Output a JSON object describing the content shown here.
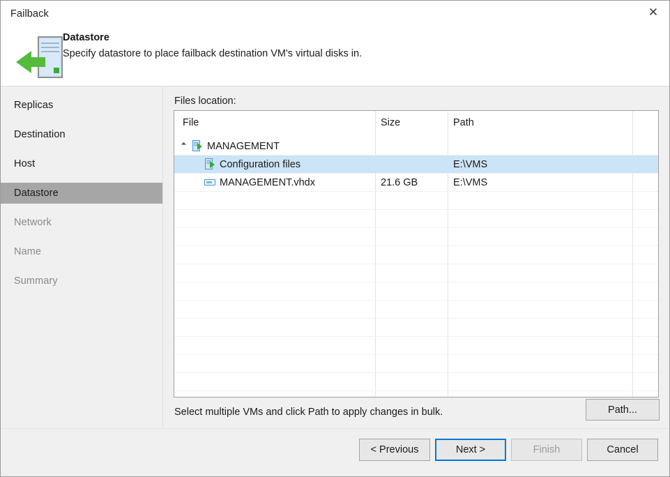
{
  "window": {
    "title": "Failback",
    "close_icon": "close-icon",
    "close_glyph": "✕"
  },
  "banner": {
    "icon": "server-failback-icon",
    "heading": "Datastore",
    "subtitle": "Specify datastore to place failback destination VM's virtual disks in."
  },
  "sidebar": {
    "items": [
      {
        "label": "Replicas",
        "state": "done"
      },
      {
        "label": "Destination",
        "state": "done"
      },
      {
        "label": "Host",
        "state": "done"
      },
      {
        "label": "Datastore",
        "state": "selected"
      },
      {
        "label": "Network",
        "state": "upcoming"
      },
      {
        "label": "Name",
        "state": "upcoming"
      },
      {
        "label": "Summary",
        "state": "upcoming"
      }
    ]
  },
  "content": {
    "files_location_label": "Files location:",
    "table": {
      "columns": [
        "File",
        "Size",
        "Path"
      ],
      "rows": [
        {
          "file": "MANAGEMENT",
          "size": "",
          "path": "",
          "icon": "vm-icon",
          "indent": 1,
          "expanded": true,
          "selected": false
        },
        {
          "file": "Configuration files",
          "size": "",
          "path": "E:\\VMS",
          "icon": "vm-icon",
          "indent": 2,
          "expanded": false,
          "selected": true
        },
        {
          "file": "MANAGEMENT.vhdx",
          "size": "21.6 GB",
          "path": "E:\\VMS",
          "icon": "disk-icon",
          "indent": 2,
          "expanded": false,
          "selected": false
        }
      ],
      "empty_row_count": 13
    },
    "bulk_hint": "Select multiple VMs and click Path to apply changes in bulk.",
    "path_button": "Path..."
  },
  "footer": {
    "previous": "< Previous",
    "next": "Next >",
    "finish": "Finish",
    "cancel": "Cancel",
    "finish_enabled": false,
    "next_focused": true
  },
  "colors": {
    "selection_blue": "#cce4f7",
    "focus_blue": "#0078d7",
    "sidebar_bg": "#f0f0f0",
    "sidebar_selected": "#a6a6a6",
    "accent_green": "#3aa83a",
    "icon_blue": "#3f9ad6"
  }
}
